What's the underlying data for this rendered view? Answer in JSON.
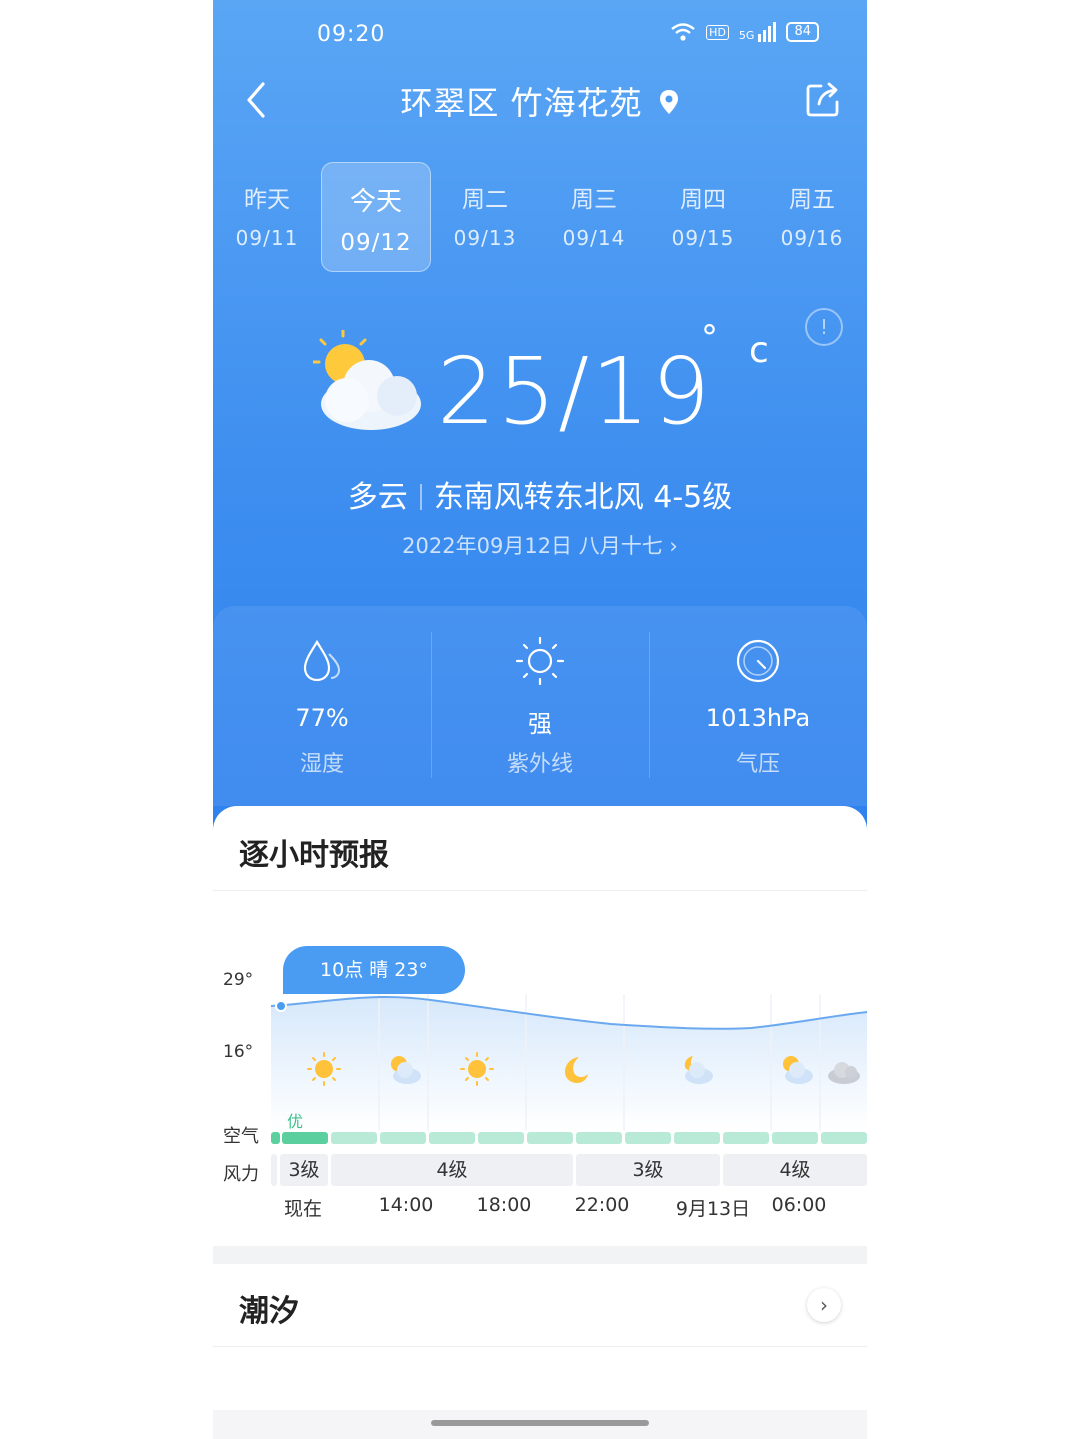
{
  "status_bar": {
    "time": "09:20",
    "net1": "HD",
    "net2": "5G",
    "battery": "84"
  },
  "header": {
    "title": "环翠区 竹海花苑"
  },
  "days": [
    {
      "name": "昨天",
      "date": "09/11"
    },
    {
      "name": "今天",
      "date": "09/12",
      "selected": true
    },
    {
      "name": "周二",
      "date": "09/13"
    },
    {
      "name": "周三",
      "date": "09/14"
    },
    {
      "name": "周四",
      "date": "09/15"
    },
    {
      "name": "周五",
      "date": "09/16"
    }
  ],
  "current": {
    "info_icon": "!",
    "temp": "25/19",
    "deg": "°",
    "unit": "c",
    "weather": "多云",
    "wind": "东南风转东北风 4-5级",
    "date_line": "2022年09月12日 八月十七 ›"
  },
  "stats": [
    {
      "value": "77%",
      "label": "湿度",
      "icon": "humidity-icon"
    },
    {
      "value": "强",
      "label": "紫外线",
      "icon": "uv-sun-icon"
    },
    {
      "value": "1013hPa",
      "label": "气压",
      "icon": "pressure-gauge-icon"
    }
  ],
  "hourly": {
    "title": "逐小时预报",
    "y_max": "29°",
    "y_min": "16°",
    "tooltip": "10点 晴 23°",
    "air_label": "空气",
    "air_quality": "优",
    "wind_label": "风力",
    "wind_segments": [
      "3级",
      "4级",
      "3级",
      "4级"
    ],
    "times": [
      "现在",
      "14:00",
      "18:00",
      "22:00",
      "9月13日",
      "06:00"
    ]
  },
  "tide": {
    "title": "潮汐",
    "chevron": "›"
  }
}
